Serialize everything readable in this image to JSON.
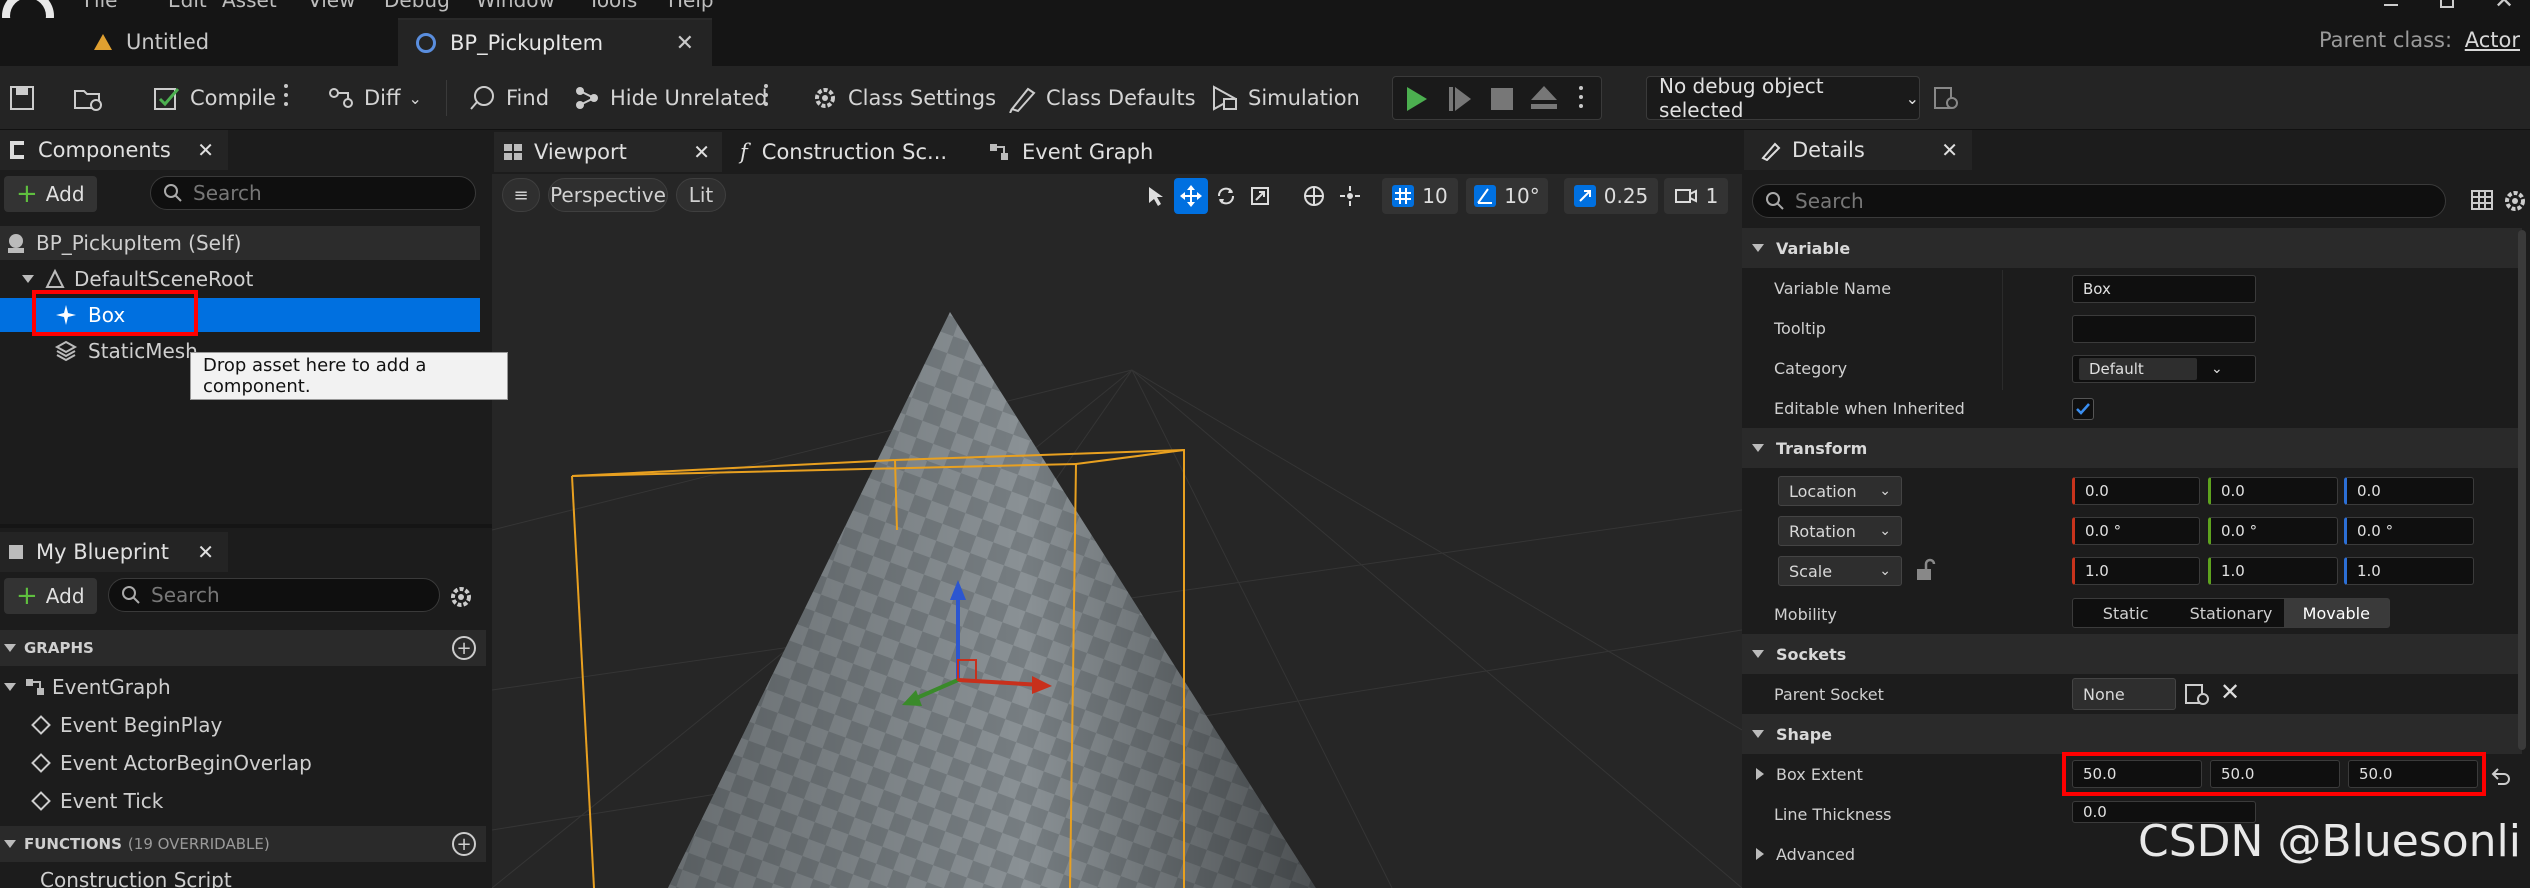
{
  "menu": [
    "File",
    "Edit",
    "Asset",
    "View",
    "Debug",
    "Window",
    "Tools",
    "Help"
  ],
  "tabs": [
    {
      "label": "Untitled"
    },
    {
      "label": "BP_PickupItem"
    }
  ],
  "parent_class": {
    "label": "Parent class:",
    "value": "Actor"
  },
  "toolbar": {
    "compile": "Compile",
    "diff": "Diff",
    "find": "Find",
    "hide_unrelated": "Hide Unrelated",
    "class_settings": "Class Settings",
    "class_defaults": "Class Defaults",
    "simulation": "Simulation",
    "debug_object": "No debug object selected"
  },
  "components": {
    "title": "Components",
    "add": "Add",
    "search_placeholder": "Search",
    "self": "BP_PickupItem (Self)",
    "root": "DefaultSceneRoot",
    "box": "Box",
    "mesh": "StaticMesh",
    "tooltip": "Drop asset here to add a component."
  },
  "blueprint": {
    "title": "My Blueprint",
    "add": "Add",
    "search_placeholder": "Search",
    "graphs": "GRAPHS",
    "event_graph": "EventGraph",
    "events": [
      "Event BeginPlay",
      "Event ActorBeginOverlap",
      "Event Tick"
    ],
    "functions": "FUNCTIONS",
    "functions_sub": "(19 OVERRIDABLE)",
    "construction": "Construction Script"
  },
  "viewport": {
    "tabs": [
      "Viewport",
      "Construction Sc...",
      "Event Graph"
    ],
    "perspective": "Perspective",
    "lit": "Lit",
    "grid": "10",
    "angle": "10°",
    "scale": "0.25",
    "camera": "1"
  },
  "details": {
    "title": "Details",
    "search_placeholder": "Search",
    "sections": {
      "variable": "Variable",
      "transform": "Transform",
      "sockets": "Sockets",
      "shape": "Shape",
      "advanced": "Advanced"
    },
    "variable_name": {
      "label": "Variable Name",
      "value": "Box"
    },
    "tooltip": {
      "label": "Tooltip",
      "value": ""
    },
    "category": {
      "label": "Category",
      "value": "Default"
    },
    "editable": {
      "label": "Editable when Inherited",
      "checked": true
    },
    "location": {
      "label": "Location",
      "x": "0.0",
      "y": "0.0",
      "z": "0.0"
    },
    "rotation": {
      "label": "Rotation",
      "x": "0.0 °",
      "y": "0.0 °",
      "z": "0.0 °"
    },
    "scale": {
      "label": "Scale",
      "x": "1.0",
      "y": "1.0",
      "z": "1.0"
    },
    "mobility": {
      "label": "Mobility",
      "options": [
        "Static",
        "Stationary",
        "Movable"
      ],
      "selected": "Movable"
    },
    "parent_socket": {
      "label": "Parent Socket",
      "value": "None"
    },
    "box_extent": {
      "label": "Box Extent",
      "x": "50.0",
      "y": "50.0",
      "z": "50.0"
    },
    "line_thickness": {
      "label": "Line Thickness",
      "value": "0.0"
    }
  },
  "watermark": "CSDN @Bluesonli",
  "colors": {
    "accent": "#0070e0",
    "highlight": "#ff0000",
    "play": "#4caf50"
  }
}
